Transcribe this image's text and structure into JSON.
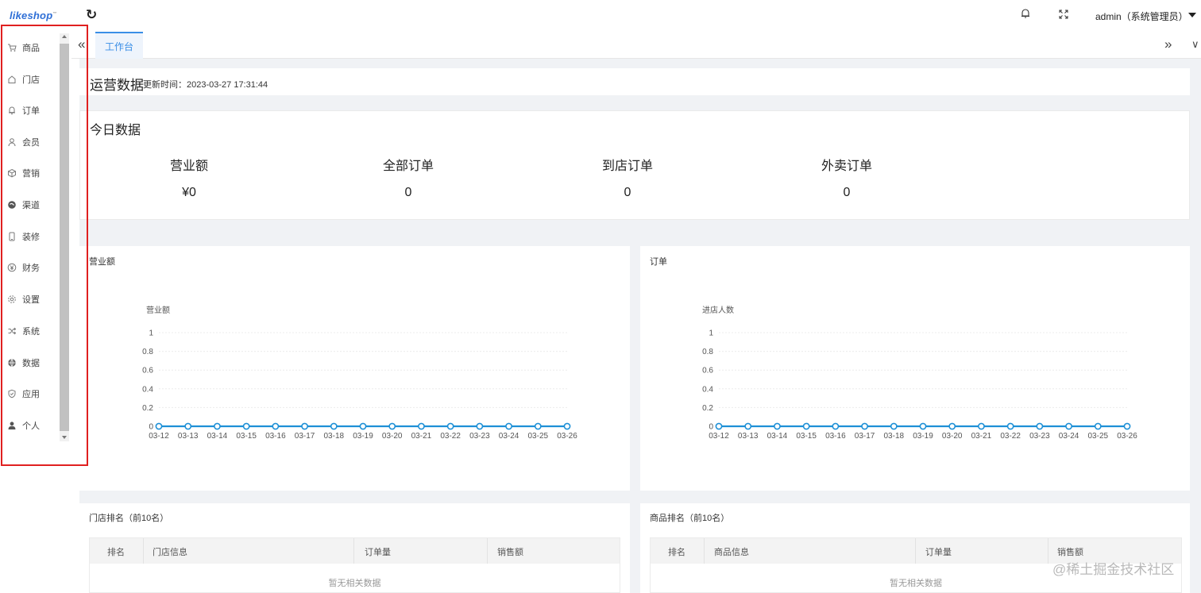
{
  "header": {
    "logo_text": "likeshop",
    "logo_mark": "™",
    "user_label": "admin（系统管理员）"
  },
  "sidebar": {
    "items": [
      {
        "label": "商品",
        "icon": "cart-icon"
      },
      {
        "label": "门店",
        "icon": "home-icon"
      },
      {
        "label": "订单",
        "icon": "bell-icon"
      },
      {
        "label": "会员",
        "icon": "user-icon"
      },
      {
        "label": "营销",
        "icon": "box-icon"
      },
      {
        "label": "渠道",
        "icon": "channel-icon"
      },
      {
        "label": "装修",
        "icon": "phone-icon"
      },
      {
        "label": "财务",
        "icon": "yen-icon"
      },
      {
        "label": "设置",
        "icon": "gear-icon"
      },
      {
        "label": "系统",
        "icon": "shuffle-icon"
      },
      {
        "label": "数据",
        "icon": "globe-icon"
      },
      {
        "label": "应用",
        "icon": "shield-icon"
      },
      {
        "label": "个人",
        "icon": "person-icon"
      }
    ],
    "highlight_color": "#e02020"
  },
  "tabs": [
    {
      "label": "工作台",
      "active": true
    }
  ],
  "operations": {
    "title": "运营数据",
    "updated": "更新时间：2023-03-27 17:31:44"
  },
  "today": {
    "title": "今日数据",
    "stats": [
      {
        "label": "营业额",
        "value": "¥0"
      },
      {
        "label": "全部订单",
        "value": "0"
      },
      {
        "label": "到店订单",
        "value": "0"
      },
      {
        "label": "外卖订单",
        "value": "0"
      }
    ]
  },
  "chart_data": [
    {
      "type": "line",
      "panel_title": "营业额",
      "title": "",
      "ylabel": "营业额",
      "xlabel": "",
      "ylim": [
        0,
        1
      ],
      "yticks": [
        0,
        0.2,
        0.4,
        0.6,
        0.8,
        1
      ],
      "categories": [
        "03-12",
        "03-13",
        "03-14",
        "03-15",
        "03-16",
        "03-17",
        "03-18",
        "03-19",
        "03-20",
        "03-21",
        "03-22",
        "03-23",
        "03-24",
        "03-25",
        "03-26"
      ],
      "series": [
        {
          "name": "",
          "values": [
            0,
            0,
            0,
            0,
            0,
            0,
            0,
            0,
            0,
            0,
            0,
            0,
            0,
            0,
            0
          ],
          "color": "#1e90d6"
        }
      ],
      "grid": true
    },
    {
      "type": "line",
      "panel_title": "订单",
      "title": "",
      "ylabel": "进店人数",
      "xlabel": "",
      "ylim": [
        0,
        1
      ],
      "yticks": [
        0,
        0.2,
        0.4,
        0.6,
        0.8,
        1
      ],
      "categories": [
        "03-12",
        "03-13",
        "03-14",
        "03-15",
        "03-16",
        "03-17",
        "03-18",
        "03-19",
        "03-20",
        "03-21",
        "03-22",
        "03-23",
        "03-24",
        "03-25",
        "03-26"
      ],
      "series": [
        {
          "name": "",
          "values": [
            0,
            0,
            0,
            0,
            0,
            0,
            0,
            0,
            0,
            0,
            0,
            0,
            0,
            0,
            0
          ],
          "color": "#1e90d6"
        }
      ],
      "grid": true
    }
  ],
  "store_rank": {
    "title": "门店排名（前10名）",
    "columns": [
      "排名",
      "门店信息",
      "订单量",
      "销售额"
    ],
    "empty_text": "暂无相关数据"
  },
  "product_rank": {
    "title": "商品排名（前10名）",
    "columns": [
      "排名",
      "商品信息",
      "订单量",
      "销售额"
    ],
    "empty_text": "暂无相关数据"
  },
  "watermark": "@稀土掘金技术社区"
}
